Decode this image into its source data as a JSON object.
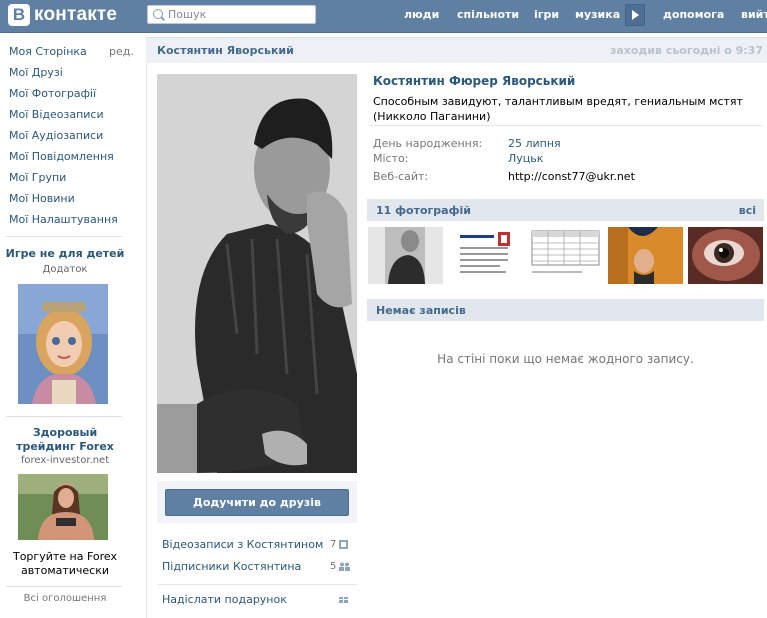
{
  "header": {
    "logo_letter": "B",
    "logo_text": "контакте",
    "search_placeholder": "Пошук",
    "nav": [
      "люди",
      "спільноти",
      "ігри",
      "музика",
      "допомога",
      "вийт"
    ]
  },
  "sidebar": {
    "menu": [
      "Моя Сторінка",
      "Мої Друзі",
      "Мої Фотографії",
      "Мої Відеозаписи",
      "Мої Аудіозаписи",
      "Мої Повідомлення",
      "Мої Групи",
      "Мої Новини",
      "Мої Налаштування"
    ],
    "edit_label": "ред.",
    "ad1": {
      "title": "Игре не для детей",
      "sub": "Додаток"
    },
    "ad2": {
      "title": "Здоровый трейдинг Forex",
      "sub": "forex-investor.net",
      "text": "Торгуйте на Forex автоматически"
    },
    "all_ads": "Всі оголошення"
  },
  "profile": {
    "short_name": "Костянтин Яворський",
    "last_seen": "заходив сьогодні о 9:37",
    "full_name": "Костянтин Фюрер Яворський",
    "status": "Способным завидуют, талантливым вредят, гениальным мстят (Никколо Паганини)",
    "add_friend": "Додучити до друзів",
    "videos_label": "Відеозаписи з Костянтином",
    "videos_count": "7",
    "followers_label": "Підписники Костянтина",
    "followers_count": "5",
    "gift_label": "Надіслати подарунок",
    "info": [
      {
        "label": "День народження:",
        "value": "25 липня"
      },
      {
        "label": "Місто:",
        "value": "Луцьк"
      },
      {
        "label": "Веб-сайт:",
        "value": "http://const77@ukr.net"
      }
    ],
    "photos_title": "11 фотографій",
    "photos_all": "всі",
    "wall_title": "Немає записів",
    "wall_empty": "На стіні поки що немає жодного запису."
  },
  "colors": {
    "header": "#5F7FA3",
    "link": "#2B587A",
    "section": "#E1E7ED"
  }
}
